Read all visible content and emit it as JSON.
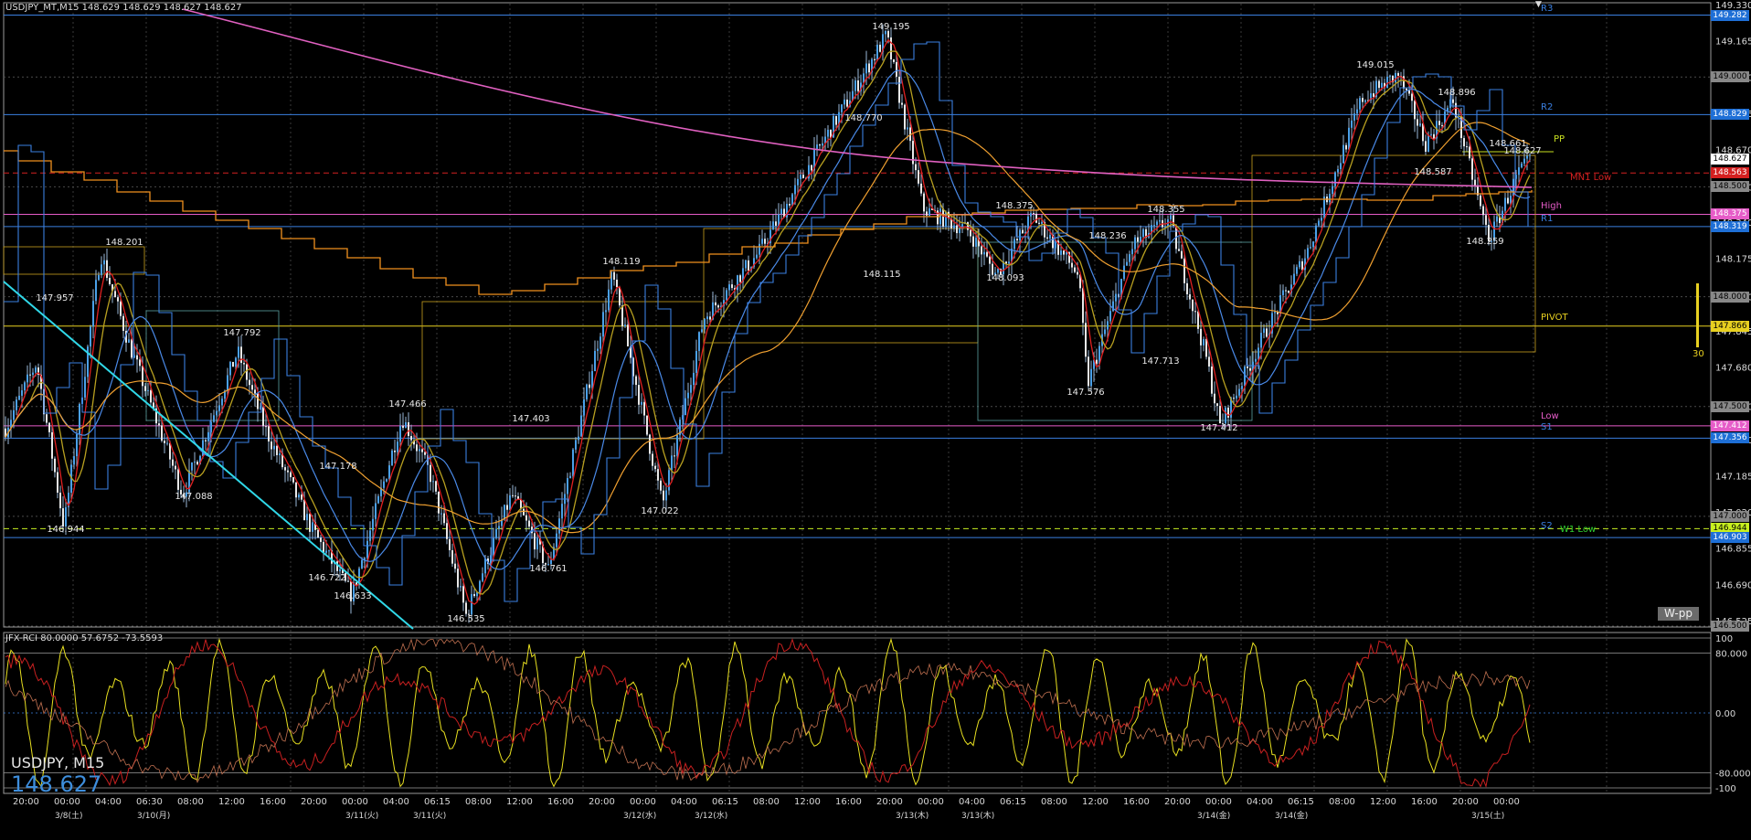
{
  "header": {
    "chart_info": "USDJPY_MT,M15  148.629 148.629 148.627 148.627",
    "oscillator_info": "JFX-RCI 80.0000 57.6752 -73.5593"
  },
  "overlay": {
    "symbol": "USDJPY, M15",
    "price": "148.627",
    "wpp_button": "W-pp",
    "volume_marker": "30"
  },
  "price_axis": {
    "labels": [
      "149.330",
      "149.165",
      "149.000",
      "148.835",
      "148.670",
      "148.500",
      "148.340",
      "148.175",
      "148.000",
      "147.845",
      "147.680",
      "147.500",
      "147.350",
      "147.185",
      "147.020",
      "146.855",
      "146.690",
      "146.525"
    ],
    "badges": [
      {
        "text": "149.282",
        "bg": "#1e6fd6",
        "fg": "#ffffff"
      },
      {
        "text": "149.000",
        "bg": "#888888",
        "fg": "#000000"
      },
      {
        "text": "148.829",
        "bg": "#1e6fd6",
        "fg": "#ffffff"
      },
      {
        "text": "148.627",
        "bg": "#ffffff",
        "fg": "#000000"
      },
      {
        "text": "148.563",
        "bg": "#d42020",
        "fg": "#ffffff"
      },
      {
        "text": "148.500",
        "bg": "#888888",
        "fg": "#000000"
      },
      {
        "text": "148.375",
        "bg": "#e65cc8",
        "fg": "#ffffff"
      },
      {
        "text": "148.319",
        "bg": "#1e6fd6",
        "fg": "#ffffff"
      },
      {
        "text": "148.000",
        "bg": "#888888",
        "fg": "#000000"
      },
      {
        "text": "147.866",
        "bg": "#e8d020",
        "fg": "#000000"
      },
      {
        "text": "147.500",
        "bg": "#888888",
        "fg": "#000000"
      },
      {
        "text": "147.412",
        "bg": "#e65cc8",
        "fg": "#ffffff"
      },
      {
        "text": "147.356",
        "bg": "#1e6fd6",
        "fg": "#ffffff"
      },
      {
        "text": "147.000",
        "bg": "#888888",
        "fg": "#000000"
      },
      {
        "text": "146.944",
        "bg": "#c8f020",
        "fg": "#000000"
      },
      {
        "text": "146.903",
        "bg": "#1e6fd6",
        "fg": "#ffffff"
      },
      {
        "text": "146.500",
        "bg": "#888888",
        "fg": "#000000"
      }
    ],
    "osc_labels": [
      "100",
      "80.000",
      "0.00",
      "-80.000",
      "-100"
    ]
  },
  "level_labels": [
    {
      "text": "R3",
      "color": "#3a7fe0"
    },
    {
      "text": "R2",
      "color": "#3a7fe0"
    },
    {
      "text": "PP",
      "color": "#c8e020"
    },
    {
      "text": "MN1 Low",
      "color": "#d42020"
    },
    {
      "text": "High",
      "color": "#e65cc8"
    },
    {
      "text": "R1",
      "color": "#3a7fe0"
    },
    {
      "text": "PIVOT",
      "color": "#e8d020"
    },
    {
      "text": "Low",
      "color": "#e65cc8"
    },
    {
      "text": "S1",
      "color": "#3a7fe0"
    },
    {
      "text": "S2",
      "color": "#3a7fe0"
    },
    {
      "text": "W1 Low",
      "color": "#30d030"
    }
  ],
  "peak_labels": [
    "149.195",
    "148.770",
    "148.115",
    "148.201",
    "147.957",
    "147.792",
    "147.466",
    "147.403",
    "147.178",
    "147.088",
    "146.944",
    "146.722",
    "146.633",
    "146.535",
    "146.761",
    "148.119",
    "147.022",
    "148.375",
    "148.093",
    "148.236",
    "148.355",
    "147.713",
    "147.576",
    "147.412",
    "149.015",
    "148.896",
    "148.661",
    "148.627",
    "148.587",
    "148.259"
  ],
  "time_axis": {
    "labels": [
      "20:00",
      "00:00",
      "04:00",
      "06:30",
      "08:00",
      "12:00",
      "16:00",
      "20:00",
      "00:00",
      "04:00",
      "06:15",
      "08:00",
      "12:00",
      "16:00",
      "20:00",
      "00:00",
      "04:00",
      "06:15",
      "08:00",
      "12:00",
      "16:00",
      "20:00",
      "00:00",
      "04:00",
      "06:15",
      "08:00",
      "12:00",
      "16:00",
      "20:00",
      "00:00",
      "04:00",
      "06:15",
      "08:00",
      "12:00",
      "16:00",
      "20:00",
      "00:00"
    ],
    "dates": [
      "3/8(土)",
      "3/10(月)",
      "3/11(火)",
      "3/11(火)",
      "3/12(水)",
      "3/12(水)",
      "3/13(木)",
      "3/13(木)",
      "3/14(金)",
      "3/14(金)",
      "3/15(土)"
    ]
  }
}
